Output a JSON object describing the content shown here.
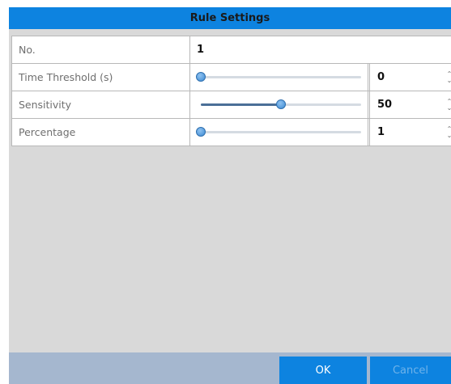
{
  "dialog": {
    "title": "Rule Settings",
    "rows": {
      "no": {
        "label": "No.",
        "value": "1"
      },
      "time_threshold": {
        "label": "Time Threshold (s)",
        "value": "0",
        "slider_fraction": 0.0
      },
      "sensitivity": {
        "label": "Sensitivity",
        "value": "50",
        "slider_fraction": 0.5
      },
      "percentage": {
        "label": "Percentage",
        "value": "1",
        "slider_fraction": 0.0
      }
    },
    "buttons": {
      "ok": "OK",
      "cancel": "Cancel"
    }
  },
  "colors": {
    "accent": "#0d83e0",
    "panel": "#d9d9d9",
    "footer": "#a5b7cf",
    "slider_fill": "#4a6f97"
  },
  "icons": {
    "spinner": "up-down-spinner-icon"
  }
}
